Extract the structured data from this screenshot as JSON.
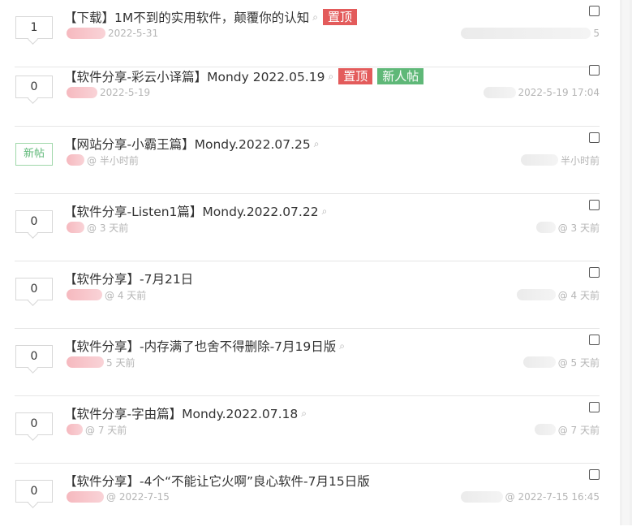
{
  "threads": [
    {
      "reply_count": "1",
      "title": "【下载】1M不到的实用软件，颠覆你的认知",
      "tags": [
        {
          "label": "置顶",
          "color": "#e35b5b"
        }
      ],
      "author_time": "2022-5-31",
      "last_reply_time": "5"
    },
    {
      "reply_count": "0",
      "title": "【软件分享-彩云小译篇】Mondy 2022.05.19",
      "tags": [
        {
          "label": "置顶",
          "color": "#e35b5b"
        },
        {
          "label": "新人帖",
          "color": "#5fb878"
        }
      ],
      "author_time": "2022-5-19",
      "last_reply_time": "2022-5-19 17:04"
    },
    {
      "reply_count": "新帖",
      "title": "【网站分享-小霸王篇】Mondy.2022.07.25",
      "tags": [],
      "author_time": "@ 半小时前",
      "last_reply_time": "半小时前"
    },
    {
      "reply_count": "0",
      "title": "【软件分享-Listen1篇】Mondy.2022.07.22",
      "tags": [],
      "author_time": "@ 3 天前",
      "last_reply_time": "@ 3 天前"
    },
    {
      "reply_count": "0",
      "title": "【软件分享】-7月21日",
      "tags": [],
      "author_time": "@ 4 天前",
      "last_reply_time": "@ 4 天前"
    },
    {
      "reply_count": "0",
      "title": "【软件分享】-内存满了也舍不得删除-7月19日版",
      "tags": [],
      "author_time": "5 天前",
      "last_reply_time": "@ 5 天前"
    },
    {
      "reply_count": "0",
      "title": "【软件分享-字由篇】Mondy.2022.07.18",
      "tags": [],
      "author_time": "@ 7 天前",
      "last_reply_time": "@ 7 天前"
    },
    {
      "reply_count": "0",
      "title": "【软件分享】-4个“不能让它火啊”良心软件-7月15日版",
      "tags": [],
      "author_time": "@ 2022-7-15",
      "last_reply_time": "@ 2022-7-15 16:45"
    }
  ],
  "icons": {
    "attachment": "paperclip-icon",
    "checkbox": "checkbox-icon"
  },
  "colors": {
    "tag_red": "#e35b5b",
    "tag_green": "#5fb878",
    "divider": "#e6e6e6",
    "text": "#333333",
    "muted": "#b5b5b5"
  }
}
